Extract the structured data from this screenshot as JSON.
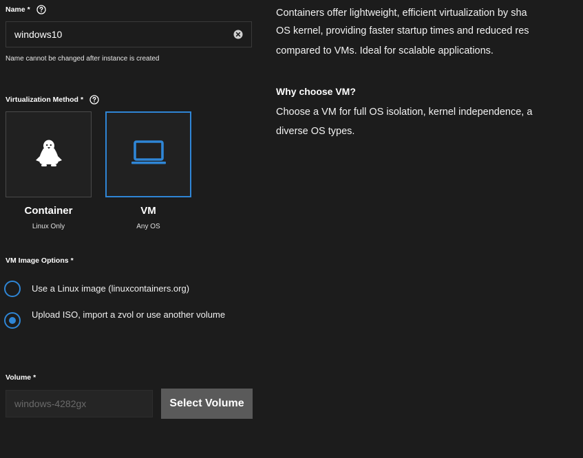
{
  "form": {
    "name": {
      "label": "Name",
      "required_mark": "*",
      "value": "windows10",
      "hint": "Name cannot be changed after instance is created"
    },
    "virtualization": {
      "label": "Virtualization Method",
      "required_mark": "*",
      "options": [
        {
          "title": "Container",
          "subtitle": "Linux Only",
          "icon": "linux-penguin-icon",
          "selected": false
        },
        {
          "title": "VM",
          "subtitle": "Any OS",
          "icon": "laptop-icon",
          "selected": true
        }
      ]
    },
    "image_options": {
      "label": "VM Image Options",
      "required_mark": "*",
      "options": [
        {
          "label": "Use a Linux image (linuxcontainers.org)",
          "checked": false
        },
        {
          "label": "Upload ISO, import a zvol or use another volume",
          "checked": true
        }
      ]
    },
    "volume": {
      "label": "Volume",
      "required_mark": "*",
      "value": "windows-4282gx",
      "button_label": "Select Volume"
    }
  },
  "info": {
    "lines": [
      "Containers offer lightweight, efficient virtualization by sha",
      "OS kernel, providing faster startup times and reduced res",
      "compared to VMs. Ideal for scalable applications."
    ],
    "heading": "Why choose VM?",
    "vm_lines": [
      "Choose a VM for full OS isolation, kernel independence, a",
      "diverse OS types."
    ]
  },
  "colors": {
    "background": "#1c1c1c",
    "accent": "#2f86d6",
    "button_bg": "#5a5a5a"
  }
}
